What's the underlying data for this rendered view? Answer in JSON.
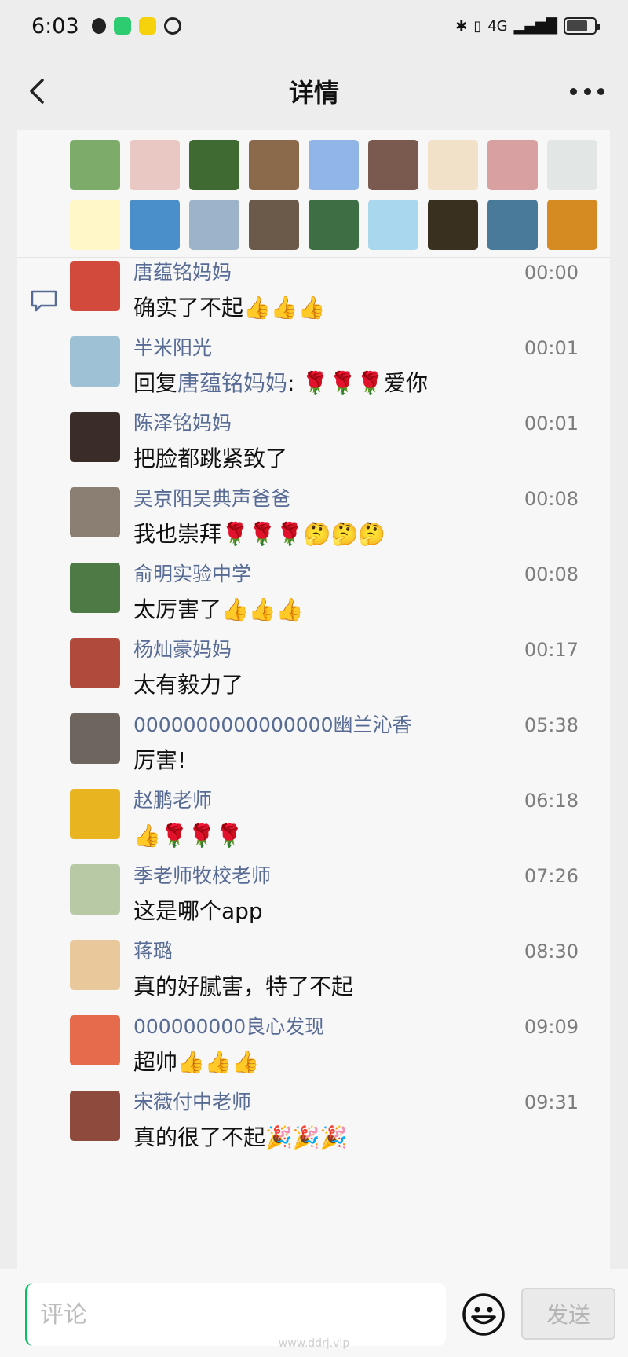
{
  "status_bar": {
    "time": "6:03",
    "network": "4G",
    "battery_level": 0.75
  },
  "nav": {
    "title": "详情"
  },
  "likes": {
    "avatar_colors": [
      "#7cab6a",
      "#e9c8c4",
      "#3f6b33",
      "#8b6a4c",
      "#8fb6e6",
      "#7a5a4e",
      "#f2e1c9",
      "#d9a0a2",
      "#e2e7e6",
      "#fff7c8",
      "#4a8fc9",
      "#9db3c9",
      "#6b5a4a",
      "#3e6f44",
      "#a9d7ee",
      "#3a3020",
      "#4a7a9a",
      "#d58a22"
    ]
  },
  "comments": [
    {
      "name": "唐蕴铭妈妈",
      "time": "00:00",
      "text": "确实了不起👍👍👍",
      "avatar_color": "#d24a3c"
    },
    {
      "name": "半米阳光",
      "time": "00:01",
      "reply_prefix": "回复",
      "reply_to": "唐蕴铭妈妈",
      "text": ": 🌹🌹🌹爱你",
      "avatar_color": "#9fc1d6"
    },
    {
      "name": "陈泽铭妈妈",
      "time": "00:01",
      "text": "把脸都跳紧致了",
      "avatar_color": "#3a2d28"
    },
    {
      "name": "吴京阳吴典声爸爸",
      "time": "00:08",
      "text": "我也崇拜🌹🌹🌹🤔🤔🤔",
      "avatar_color": "#8a7f72"
    },
    {
      "name": "俞明实验中学",
      "time": "00:08",
      "text": "太厉害了👍👍👍",
      "avatar_color": "#4e7a46"
    },
    {
      "name": "杨灿豪妈妈",
      "time": "00:17",
      "text": "太有毅力了",
      "avatar_color": "#b04a3c"
    },
    {
      "name": "0000000000000000幽兰沁香",
      "time": "05:38",
      "text": "厉害!",
      "avatar_color": "#6e665e"
    },
    {
      "name": "赵鹏老师",
      "time": "06:18",
      "text": "👍🌹🌹🌹",
      "avatar_color": "#e8b420"
    },
    {
      "name": "季老师牧校老师",
      "time": "07:26",
      "text": "这是哪个app",
      "avatar_color": "#b8c9a6"
    },
    {
      "name": "蒋璐",
      "time": "08:30",
      "text": "真的好腻害，特了不起",
      "avatar_color": "#e9c89b"
    },
    {
      "name": "000000000良心发现",
      "time": "09:09",
      "text": "超帅👍👍👍",
      "avatar_color": "#e66b4c"
    },
    {
      "name": "宋薇付中老师",
      "time": "09:31",
      "text": "真的很了不起🎉🎉🎉",
      "avatar_color": "#8e4a3c"
    }
  ],
  "input": {
    "placeholder": "评论",
    "send_label": "发送"
  },
  "watermark": "www.ddrj.vip"
}
